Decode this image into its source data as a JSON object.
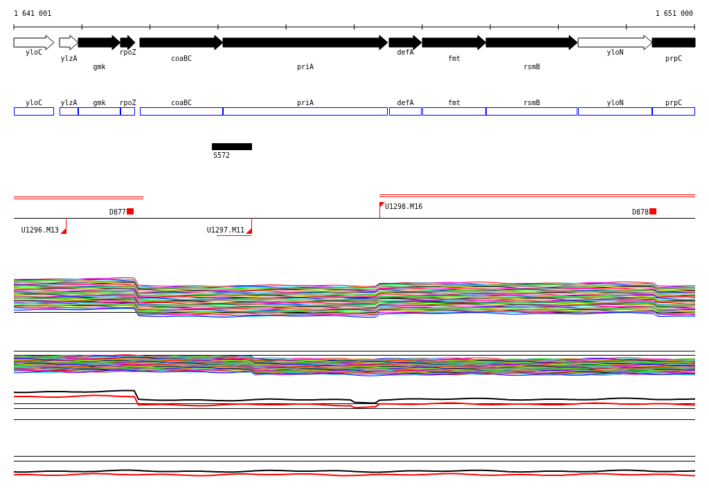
{
  "ruler": {
    "start_label": "1 641 001",
    "end_label": "1 651 000"
  },
  "genes": [
    {
      "name": "yloC",
      "filled": false
    },
    {
      "name": "ylzA",
      "filled": false
    },
    {
      "name": "gmk",
      "filled": true
    },
    {
      "name": "rpoZ",
      "filled": true
    },
    {
      "name": "coaBC",
      "filled": true
    },
    {
      "name": "priA",
      "filled": true
    },
    {
      "name": "defA",
      "filled": true
    },
    {
      "name": "fmt",
      "filled": true
    },
    {
      "name": "rsmB",
      "filled": true
    },
    {
      "name": "yloN",
      "filled": false
    },
    {
      "name": "prpC",
      "filled": true
    }
  ],
  "gene_boxes": [
    {
      "name": "yloC"
    },
    {
      "name": "ylzA"
    },
    {
      "name": "gmk"
    },
    {
      "name": "rpoZ"
    },
    {
      "name": "coaBC"
    },
    {
      "name": "priA"
    },
    {
      "name": "defA"
    },
    {
      "name": "fmt"
    },
    {
      "name": "rsmB"
    },
    {
      "name": "yloN"
    },
    {
      "name": "prpC"
    }
  ],
  "features": [
    {
      "label": "S572"
    }
  ],
  "markers": [
    {
      "label": "D877",
      "kind": "square"
    },
    {
      "label": "U1298.M16",
      "kind": "flag"
    },
    {
      "label": "D878",
      "kind": "square"
    },
    {
      "label": "U1296.M13",
      "kind": "corner"
    },
    {
      "label": "U1297.M11",
      "kind": "corner"
    }
  ]
}
